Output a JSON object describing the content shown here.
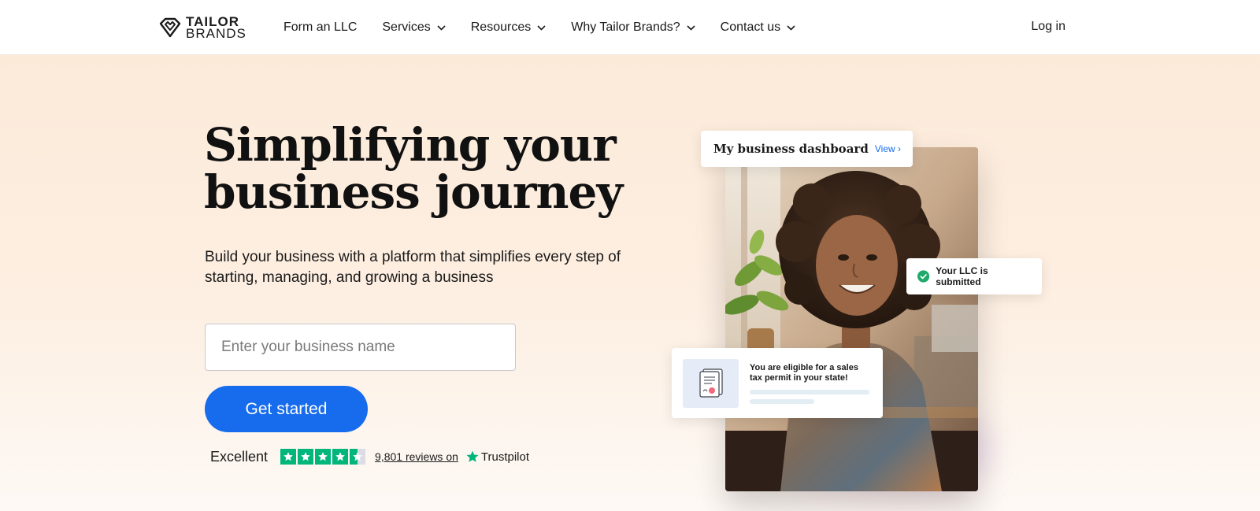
{
  "header": {
    "logo": {
      "line1": "TAILOR",
      "line2": "BRANDS"
    },
    "nav": [
      {
        "label": "Form an LLC",
        "has_dropdown": false
      },
      {
        "label": "Services",
        "has_dropdown": true
      },
      {
        "label": "Resources",
        "has_dropdown": true
      },
      {
        "label": "Why Tailor Brands?",
        "has_dropdown": true
      },
      {
        "label": "Contact us",
        "has_dropdown": true
      }
    ],
    "login_label": "Log in"
  },
  "hero": {
    "title_line1": "Simplifying your",
    "title_line2": "business journey",
    "subtitle": "Build your business with a platform that simplifies every step of starting, managing, and growing a business",
    "input_placeholder": "Enter your business name",
    "cta_label": "Get started",
    "trustpilot": {
      "rating_label": "Excellent",
      "stars": 4.5,
      "reviews_link": "9,801 reviews on",
      "brand": "Trustpilot"
    }
  },
  "visual": {
    "dashboard_card": {
      "title": "My business dashboard",
      "link": "View ›"
    },
    "llc_card": {
      "text": "Your LLC is submitted"
    },
    "tax_card": {
      "text": "You are eligible for a sales tax permit in your state!"
    }
  },
  "colors": {
    "accent": "#176ced",
    "trustpilot_green": "#00b67a",
    "hero_bg": "#fcead9",
    "success": "#1faa6b"
  }
}
